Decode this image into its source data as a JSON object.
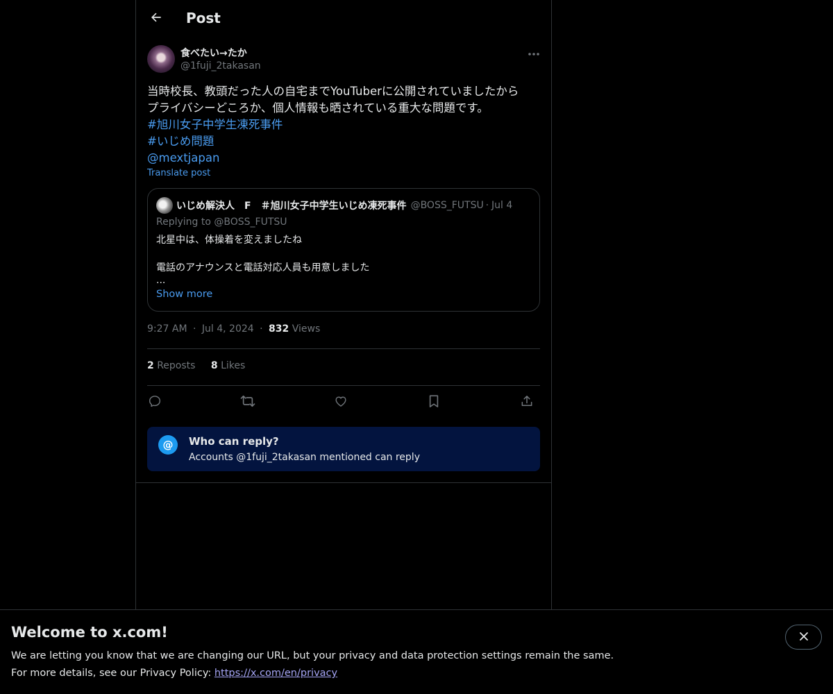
{
  "header": {
    "title": "Post",
    "back_icon": "arrow-left-icon"
  },
  "post": {
    "author": {
      "name": "食べたい→たか",
      "handle": "@1fuji_2takasan"
    },
    "text_lines": [
      "当時校長、教頭だった人の自宅までYouTuberに公開されていましたから",
      "プライバシーどころか、個人情報も晒されている重大な問題です。"
    ],
    "hashtags": [
      "#旭川女子中学生凍死事件",
      "#いじめ問題"
    ],
    "mention": "@mextjapan",
    "translate_label": "Translate post",
    "quote": {
      "name": "いじめ解決人　F　＃旭川女子中学生いじめ凍死事件",
      "handle": "@BOSS_FUTSU",
      "dot": "·",
      "date": "Jul 4",
      "replying_to": "Replying to @BOSS_FUTSU",
      "body_line1": "北星中は、体操着を変えましたね",
      "body_line2": "電話のアナウンスと電話対応人員も用意しました",
      "body_line3": "...",
      "show_more": "Show more"
    },
    "time": "9:27 AM",
    "date": "Jul 4, 2024",
    "sep": "·",
    "views_count": "832",
    "views_label": "Views",
    "reposts_count": "2",
    "reposts_label": "Reposts",
    "likes_count": "8",
    "likes_label": "Likes"
  },
  "actions": [
    "reply-icon",
    "repost-icon",
    "like-icon",
    "bookmark-icon",
    "share-icon"
  ],
  "who_can_reply": {
    "icon": "@",
    "title": "Who can reply?",
    "subtitle": "Accounts @1fuji_2takasan mentioned can reply"
  },
  "banner": {
    "title": "Welcome to x.com!",
    "line1": "We are letting you know that we are changing our URL, but your privacy and data protection settings remain the same.",
    "line2_prefix": "For more details, see our Privacy Policy: ",
    "link": "https://x.com/en/privacy"
  },
  "colors": {
    "background": "#000000",
    "accent_link": "#4a9cf0",
    "muted": "#71767b",
    "border": "#2f3336",
    "notice_bg": "#03143f"
  }
}
